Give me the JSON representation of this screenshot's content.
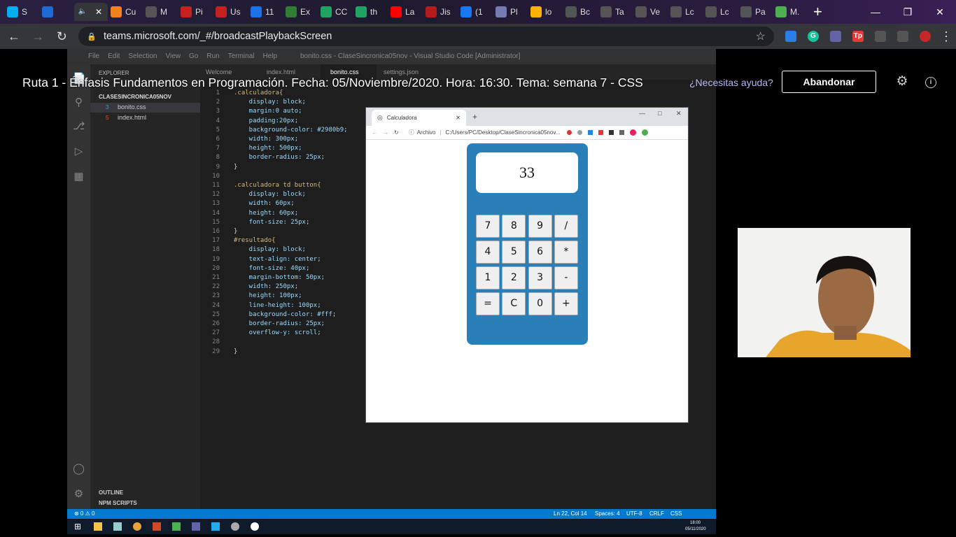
{
  "browser": {
    "tabs": [
      {
        "icon": "skype-icon",
        "label": "S",
        "active": false
      },
      {
        "icon": "m-icon",
        "label": "",
        "active": false
      },
      {
        "icon": "sound-icon",
        "label": "",
        "active": true
      },
      {
        "icon": "in-icon",
        "label": "Cu",
        "active": false
      },
      {
        "icon": "globe-icon",
        "label": "M",
        "active": false
      },
      {
        "icon": "gmail-icon",
        "label": "Pi",
        "active": false
      },
      {
        "icon": "gmail-icon",
        "label": "Us",
        "active": false
      },
      {
        "icon": "contact-icon",
        "label": "11",
        "active": false
      },
      {
        "icon": "check-icon",
        "label": "Ex",
        "active": false
      },
      {
        "icon": "drive-icon",
        "label": "CC",
        "active": false
      },
      {
        "icon": "drive-icon",
        "label": "th",
        "active": false
      },
      {
        "icon": "youtube-icon",
        "label": "La",
        "active": false
      },
      {
        "icon": "app-icon",
        "label": "Jis",
        "active": false
      },
      {
        "icon": "facebook-icon",
        "label": "(1",
        "active": false
      },
      {
        "icon": "php-icon",
        "label": "Pl",
        "active": false
      },
      {
        "icon": "image-icon",
        "label": "lo",
        "active": false
      },
      {
        "icon": "globe-icon",
        "label": "Bc",
        "active": false
      },
      {
        "icon": "globe-icon",
        "label": "Ta",
        "active": false
      },
      {
        "icon": "globe-icon",
        "label": "Ve",
        "active": false
      },
      {
        "icon": "globe-icon",
        "label": "Lc",
        "active": false
      },
      {
        "icon": "globe-icon",
        "label": "Lc",
        "active": false
      },
      {
        "icon": "globe-icon",
        "label": "Pa",
        "active": false
      },
      {
        "icon": "loader-icon",
        "label": "M.",
        "active": false
      }
    ],
    "url": "teams.microsoft.com/_#/broadcastPlaybackScreen"
  },
  "teams": {
    "title": "Ruta 1 - Énfasis Fundamentos en Programación. Fecha: 05/Noviembre/2020. Hora: 16:30. Tema: semana 7 - CSS",
    "help": "¿Necesitas ayuda?",
    "leave": "Abandonar"
  },
  "vscode": {
    "window_title": "bonito.css - ClaseSincronica05nov - Visual Studio Code [Administrator]",
    "menu": [
      "File",
      "Edit",
      "Selection",
      "View",
      "Go",
      "Run",
      "Terminal",
      "Help"
    ],
    "explorer_title": "EXPLORER",
    "folder": "CLASESINCRONICA05NOV",
    "files": [
      "bonito.css",
      "index.html"
    ],
    "outline": "OUTLINE",
    "npm": "NPM SCRIPTS",
    "tabs": [
      "Welcome",
      "index.html",
      "bonito.css",
      "settings.json"
    ],
    "code_lines": [
      ".calculadora{",
      "    display: block;",
      "    margin:0 auto;",
      "    padding:20px;",
      "    background-color: #2980b9;",
      "    width: 300px;",
      "    height: 500px;",
      "    border-radius: 25px;",
      "}",
      "",
      ".calculadora td button{",
      "    display: block;",
      "    width: 60px;",
      "    height: 60px;",
      "    font-size: 25px;",
      "}",
      "#resultado{",
      "    display: block;",
      "    text-align: center;",
      "    font-size: 40px;",
      "    margin-bottom: 50px;",
      "    width: 250px;",
      "    height: 100px;",
      "    line-height: 100px;",
      "    background-color: #fff;",
      "    border-radius: 25px;",
      "    overflow-y: scroll;",
      "",
      "}"
    ],
    "status_left": "⊗ 0 ⚠ 0",
    "status_right": [
      "Ln 22, Col 14",
      "Spaces: 4",
      "UTF-8",
      "CRLF",
      "CSS"
    ],
    "clock_time": "18:00",
    "clock_date": "05/11/2020"
  },
  "calc_browser": {
    "tab_title": "Calculadora",
    "addr_label": "Archivo",
    "addr_path": "C:/Users/PC/Desktop/ClaseSincronica05nov...",
    "result": "33",
    "keys": [
      "7",
      "8",
      "9",
      "/",
      "4",
      "5",
      "6",
      "*",
      "1",
      "2",
      "3",
      "-",
      "=",
      "C",
      "0",
      "+"
    ]
  },
  "colors": {
    "calc_bg": "#2980b9",
    "vscode_status": "#007acc"
  }
}
